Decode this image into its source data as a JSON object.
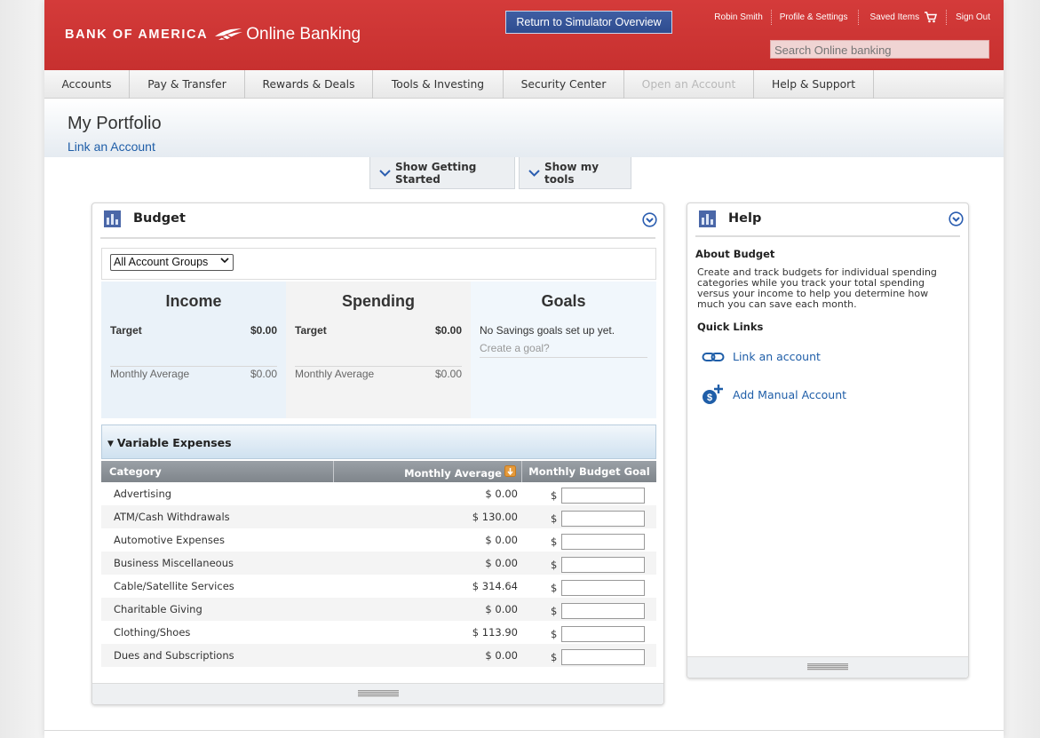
{
  "header": {
    "logo_text": "BANK OF AMERICA",
    "logo_product": "Online Banking",
    "simulator_button": "Return to Simulator Overview",
    "user_name": "Robin Smith",
    "profile_link": "Profile & Settings",
    "saved_items": "Saved Items",
    "sign_out": "Sign Out",
    "search_placeholder": "Search Online banking",
    "brand_color": "#c7302f"
  },
  "nav": {
    "items": [
      {
        "label": "Accounts"
      },
      {
        "label": "Pay & Transfer"
      },
      {
        "label": "Rewards & Deals"
      },
      {
        "label": "Tools & Investing"
      },
      {
        "label": "Security Center"
      },
      {
        "label": "Open an Account"
      },
      {
        "label": "Help & Support"
      }
    ]
  },
  "page": {
    "title": "My Portfolio",
    "link_account": "Link an Account",
    "show_getting_started": "Show Getting Started",
    "show_tools": "Show my tools"
  },
  "budget": {
    "title": "Budget",
    "account_group": "All Account Groups",
    "income": {
      "title": "Income",
      "target_label": "Target",
      "target_value": "$0.00",
      "avg_label": "Monthly Average",
      "avg_value": "$0.00"
    },
    "spending": {
      "title": "Spending",
      "target_label": "Target",
      "target_value": "$0.00",
      "avg_label": "Monthly Average",
      "avg_value": "$0.00"
    },
    "goals": {
      "title": "Goals",
      "message": "No Savings goals set up yet.",
      "create_link": "Create a goal?"
    },
    "variable_expenses": "Variable Expenses",
    "columns": {
      "category": "Category",
      "monthly_average": "Monthly Average",
      "budget_goal": "Monthly Budget Goal"
    },
    "currency_symbol": "$",
    "rows": [
      {
        "category": "Advertising",
        "average": "$ 0.00"
      },
      {
        "category": "ATM/Cash Withdrawals",
        "average": "$ 130.00"
      },
      {
        "category": "Automotive Expenses",
        "average": "$ 0.00"
      },
      {
        "category": "Business Miscellaneous",
        "average": "$ 0.00"
      },
      {
        "category": "Cable/Satellite Services",
        "average": "$ 314.64"
      },
      {
        "category": "Charitable Giving",
        "average": "$ 0.00"
      },
      {
        "category": "Clothing/Shoes",
        "average": "$ 113.90"
      },
      {
        "category": "Dues and Subscriptions",
        "average": "$ 0.00"
      }
    ]
  },
  "help": {
    "title": "Help",
    "about_title": "About Budget",
    "about_text": "Create and track budgets for individual spending categories while you track your total spending versus your income to help you determine how much you can save each month.",
    "quick_links_title": "Quick Links",
    "link_account": "Link an account",
    "add_manual": "Add Manual Account"
  }
}
